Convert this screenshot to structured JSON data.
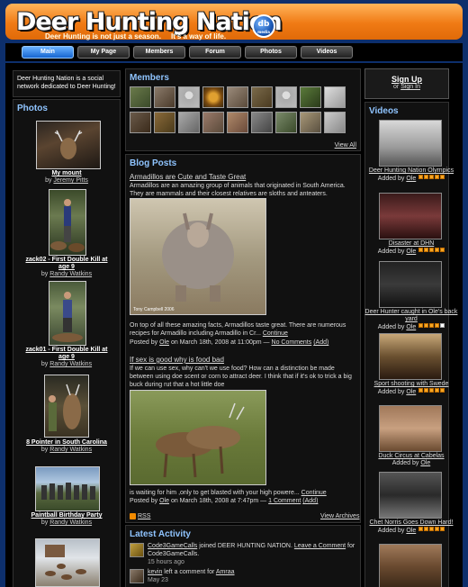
{
  "header": {
    "logo_text": "Deer Hunting Nation",
    "tagline": "Deer Hunting is not just a season.     It's a way of life.",
    "badge_main": "db",
    "badge_sub": "media"
  },
  "nav": {
    "tabs": [
      "Main",
      "My Page",
      "Members",
      "Forum",
      "Photos",
      "Videos"
    ]
  },
  "left": {
    "intro": "Deer Hunting Nation is a social network dedicated to Deer Hunting!",
    "photos_heading": "Photos",
    "by": "by",
    "photos": [
      {
        "title": "My mount",
        "author": "Jeremy Pitts"
      },
      {
        "title": "zack02 - First Double Kill at age 9",
        "author": "Randy Watkins"
      },
      {
        "title": "zack01 - First Double Kill at age 9",
        "author": "Randy Watkins"
      },
      {
        "title": "8 Pointer in South Carolina",
        "author": "Randy Watkins"
      },
      {
        "title": "Paintball Birthday Party",
        "author": "Randy Watkins"
      }
    ]
  },
  "center": {
    "members_heading": "Members",
    "view_all": "View All",
    "blog_heading": "Blog Posts",
    "posts": [
      {
        "title": "Armadillos are Cute and Taste Great",
        "intro": "Armadillos are an amazing group of animals that originated in South America. They are mammals and their closest relatives are sloths and anteaters.",
        "image_caption": "Tony Campbell 2006",
        "body": "On top of all these amazing facts, Armadillos taste great. There are numerous recipes for Armadillo including Armadillo in Cr...",
        "continue": "Continue",
        "posted_prefix": "Posted by",
        "author": "Ole",
        "posted_suffix": "on March 18th, 2008 at 11:00pm —",
        "comments": "No Comments",
        "add": "(Add)"
      },
      {
        "title": "If sex is good why is food bad",
        "intro": "If we can use sex, why can't we use food? How can a distinction be made between using doe scent or corn to attract deer. I think that if it's ok to trick a big buck during rut that a hot little doe",
        "body": "is waiting for him ,only to get blasted with your high powere...",
        "continue": "Continue",
        "posted_prefix": "Posted by",
        "author": "Ole",
        "posted_suffix": "on March 18th, 2008 at 7:47pm —",
        "comments": "1 Comment",
        "add": "(Add)"
      }
    ],
    "rss": "RSS",
    "view_archives": "View Archives",
    "activity_heading": "Latest Activity",
    "activity": [
      {
        "user": "Code3GameCalls",
        "text": "joined DEER HUNTING NATION.",
        "link": "Leave a Comment",
        "tail": "for Code3GameCalls.",
        "time": "15 hours ago"
      },
      {
        "user": "kevin",
        "text": "left a comment for",
        "link": "Amraa",
        "tail": "",
        "time": "May 23"
      }
    ]
  },
  "right": {
    "signup": "Sign Up",
    "signin_prefix": "or",
    "signin": "Sign In",
    "videos_heading": "Videos",
    "added_by": "Added by",
    "videos": [
      {
        "title": "Deer Hunting Nation Olympics",
        "author": "Ole",
        "rating": 5
      },
      {
        "title": "Disaster at DHN",
        "author": "Ole",
        "rating": 5
      },
      {
        "title": "Deer Hunter caught in Ole's back yard",
        "author": "Ole",
        "rating": 4
      },
      {
        "title": "Sport shooting with Swede",
        "author": "Ole",
        "rating": 5
      },
      {
        "title": "Duck Circus at Cabelas",
        "author": "Ole",
        "rating": 0
      },
      {
        "title": "Chet Norris Goes Down Hard!",
        "author": "Ole",
        "rating": 5
      }
    ]
  },
  "colors": {
    "accent": "#8fc4ff",
    "header_orange": "#f07a14",
    "background": "#0d2f6c",
    "star": "#f5a623"
  }
}
